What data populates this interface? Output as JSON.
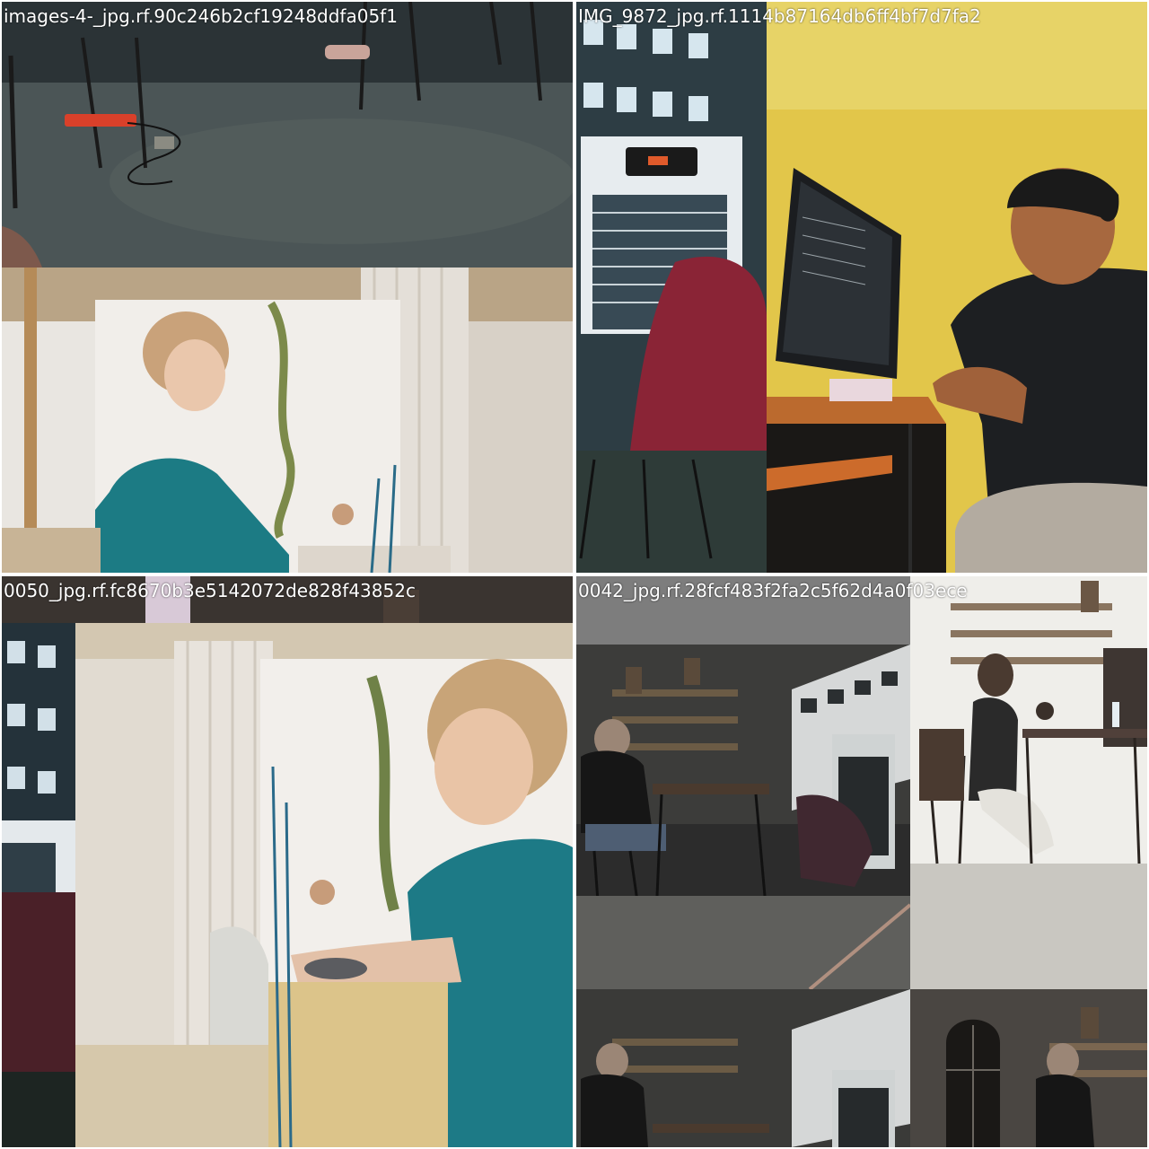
{
  "mosaic": {
    "tiles": [
      {
        "label": "images-4-_jpg.rf.90c246b2cf19248ddfa05f1"
      },
      {
        "label": "IMG_9872_jpg.rf.1114b87164db6ff4bf7d7fa2"
      },
      {
        "label": "0050_jpg.rf.fc8670b3e5142072de828f43852c"
      },
      {
        "label": "0042_jpg.rf.28fcf483f2fa2c5f62d4a0f03ece"
      }
    ]
  }
}
